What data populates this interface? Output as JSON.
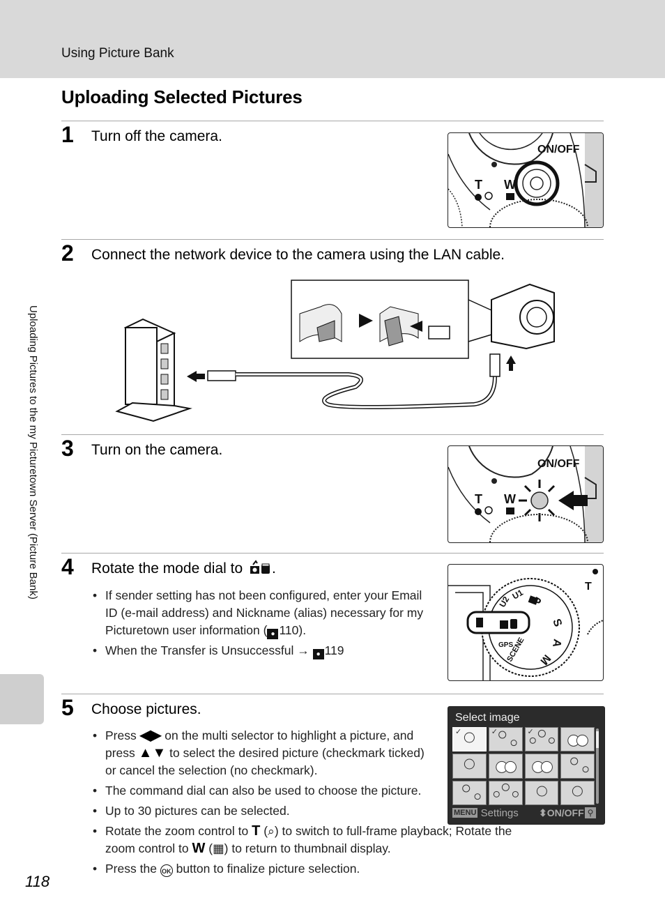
{
  "header": {
    "section_label": "Using Picture Bank",
    "page_title": "Uploading Selected Pictures"
  },
  "side_tab": {
    "text": "Uploading Pictures to the my Picturetown Server (Picture Bank)"
  },
  "page_number": "118",
  "steps": [
    {
      "number": "1",
      "text": "Turn off the camera."
    },
    {
      "number": "2",
      "text": "Connect the network device to the camera using the LAN cable."
    },
    {
      "number": "3",
      "text": "Turn on the camera."
    },
    {
      "number": "4",
      "text": "Rotate the mode dial to",
      "icon": "picture-bank-mode-icon",
      "bullets": [
        {
          "parts": [
            "If sender setting has not been configured, enter your Email ID (e-mail address) and Nickname (alias) necessary for my Picturetown user information (",
            "110",
            ")."
          ]
        },
        {
          "parts": [
            "When the Transfer is Unsuccessful → ",
            "119"
          ]
        }
      ]
    },
    {
      "number": "5",
      "text": "Choose pictures.",
      "bullets": [
        {
          "parts": [
            "Press ",
            "◀▶",
            " on the multi selector to highlight a picture, and press ",
            "▲▼",
            " to select the desired picture (checkmark ticked) or cancel the selection (no checkmark)."
          ]
        },
        {
          "parts": [
            "The command dial can also be used to choose the picture."
          ]
        },
        {
          "parts": [
            "Up to 30 pictures can be selected."
          ]
        },
        {
          "parts": [
            "Rotate the zoom control to ",
            "T",
            " (",
            "⌕",
            ") to switch to full-frame playback; Rotate the zoom control to ",
            "W",
            " (",
            "▦",
            ") to return to thumbnail display."
          ]
        },
        {
          "parts": [
            "Press the ",
            "OK",
            " button to finalize picture selection."
          ]
        }
      ]
    }
  ],
  "camera_labels": {
    "on_off": "ON/OFF",
    "tele": "T",
    "wide": "W"
  },
  "mode_dial_labels": [
    "U1",
    "U2",
    "P",
    "S",
    "A",
    "M",
    "SCENE",
    "GPS"
  ],
  "lcd": {
    "title": "Select image",
    "menu_badge": "MENU",
    "settings_label": "Settings",
    "onoff_label": "ON/OFF",
    "thumbnails": [
      {
        "checked": true,
        "highlighted": true,
        "subject": "woman"
      },
      {
        "checked": true,
        "highlighted": false,
        "subject": "woman-child"
      },
      {
        "checked": true,
        "highlighted": false,
        "subject": "family"
      },
      {
        "checked": false,
        "highlighted": false,
        "subject": "flowers"
      },
      {
        "checked": false,
        "highlighted": false,
        "subject": "woman"
      },
      {
        "checked": false,
        "highlighted": false,
        "subject": "flowers"
      },
      {
        "checked": false,
        "highlighted": false,
        "subject": "flowers"
      },
      {
        "checked": false,
        "highlighted": false,
        "subject": "woman-child"
      },
      {
        "checked": false,
        "highlighted": false,
        "subject": "woman-child"
      },
      {
        "checked": false,
        "highlighted": false,
        "subject": "family"
      },
      {
        "checked": false,
        "highlighted": false,
        "subject": "woman"
      },
      {
        "checked": false,
        "highlighted": false,
        "subject": "woman"
      }
    ]
  }
}
